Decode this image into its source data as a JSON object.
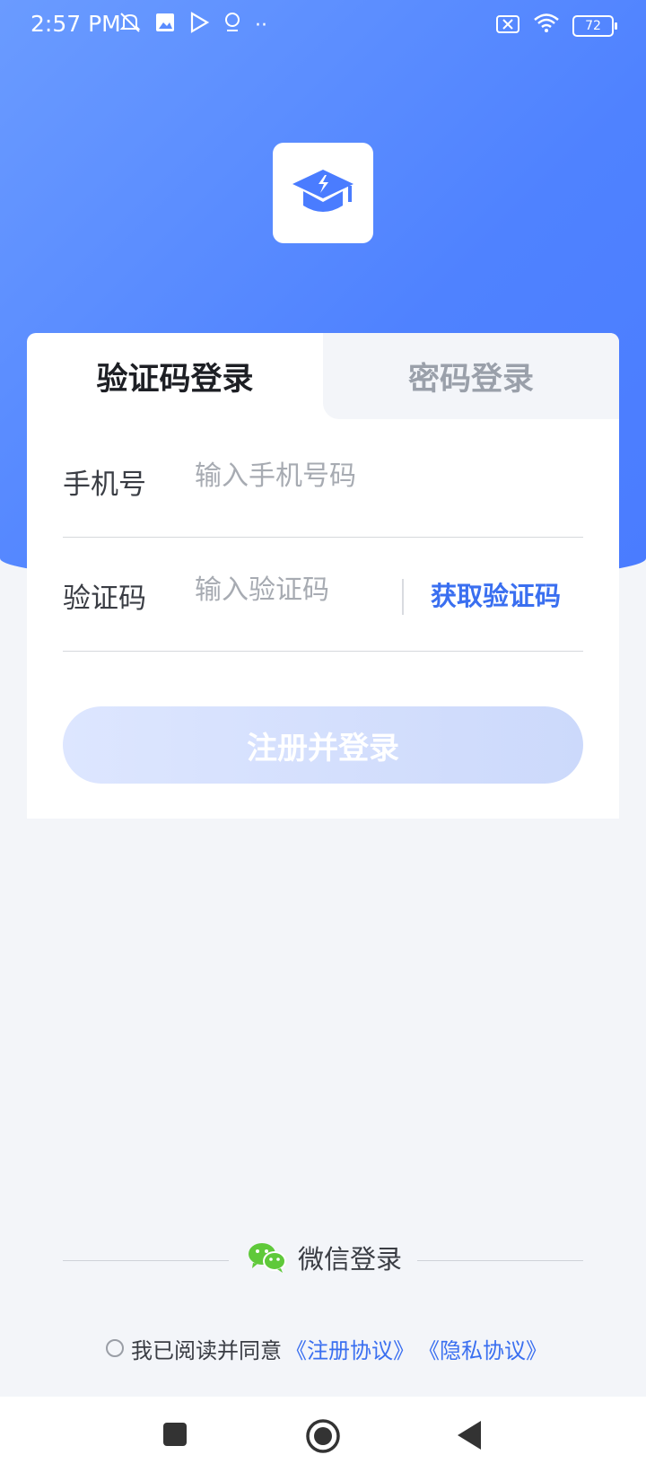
{
  "status_bar": {
    "time": "2:57 PM",
    "battery": "72",
    "icons_left": [
      "mute-icon",
      "gallery-icon",
      "play-store-icon",
      "location-icon",
      "more-dots-icon"
    ],
    "icons_right": [
      "sim-off-icon",
      "wifi-icon",
      "battery-icon"
    ]
  },
  "logo": {
    "icon": "graduation-cap-icon",
    "color": "#4a7cff"
  },
  "tabs": [
    {
      "label": "验证码登录",
      "active": true
    },
    {
      "label": "密码登录",
      "active": false
    }
  ],
  "form": {
    "phone": {
      "label": "手机号",
      "placeholder": "输入手机号码",
      "value": ""
    },
    "code": {
      "label": "验证码",
      "placeholder": "输入验证码",
      "value": ""
    },
    "get_code_label": "获取验证码",
    "submit_label": "注册并登录"
  },
  "wechat": {
    "label": "微信登录",
    "icon": "wechat-icon",
    "color": "#5fc93a"
  },
  "agreement": {
    "text": "我已阅读并同意",
    "register_link": "《注册协议》",
    "privacy_link": "《隐私协议》",
    "checked": false
  },
  "nav": [
    "recents-square-icon",
    "home-circle-icon",
    "back-triangle-icon"
  ],
  "colors": {
    "primary": "#4a7cff",
    "link": "#3a6ff0",
    "background": "#f3f5f9"
  }
}
